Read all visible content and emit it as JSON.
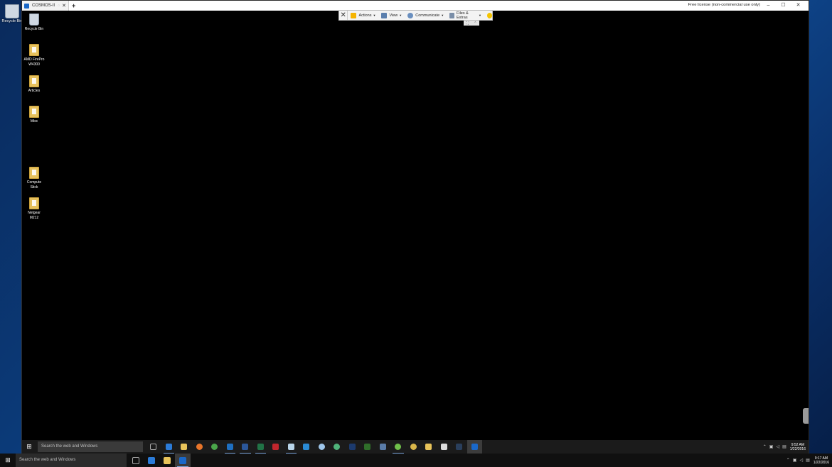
{
  "local_desktop": {
    "recycle_bin_label": "Recycle Bin"
  },
  "teamviewer": {
    "tab_label": "COSMOS-II",
    "new_tab": "+",
    "license_text": "Free license (non-commercial use only)",
    "window_controls": {
      "minimize": "–",
      "maximize": "☐",
      "close": "✕"
    },
    "toolbar": {
      "close": "✕",
      "actions_label": "Actions",
      "view_label": "View",
      "communicate_label": "Communicate",
      "files_label": "Files & Extras"
    }
  },
  "remote_desktop": {
    "icons": [
      {
        "label1": "Recycle Bin",
        "label2": ""
      },
      {
        "label1": "AMD FirePro",
        "label2": "W4300"
      },
      {
        "label1": "Articles",
        "label2": ""
      },
      {
        "label1": "Misc",
        "label2": ""
      },
      {
        "label1": "Compute",
        "label2": "Stick"
      },
      {
        "label1": "Netgear",
        "label2": "M212"
      }
    ],
    "taskbar": {
      "search_placeholder": "Search the web and Windows",
      "time": "9:52 AM",
      "date": "1/22/2016"
    }
  },
  "local_taskbar": {
    "search_placeholder": "Search the web and Windows",
    "time": "9:17 AM",
    "date": "1/22/2016"
  },
  "colors": {
    "accent": "#1a68c8",
    "wallpaper": "#0b3a78"
  }
}
